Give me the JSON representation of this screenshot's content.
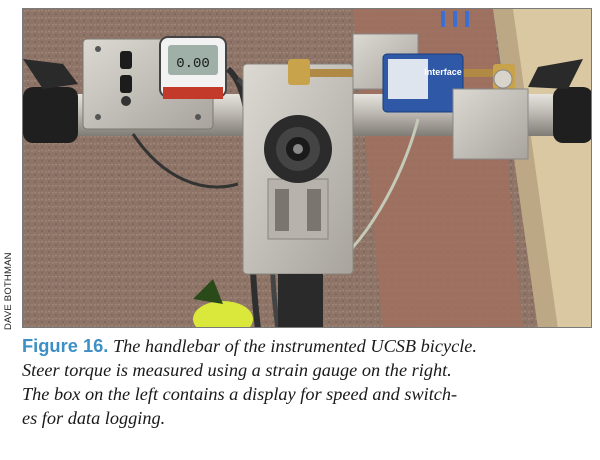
{
  "figure": {
    "label": "Figure 16.",
    "caption_lines": [
      "The handlebar of the instrumented UCSB bicycle.",
      "Steer torque is measured using a strain gauge on the right.",
      "The box on the left contains a  display for speed and switch-",
      "es for data logging."
    ],
    "photo_credit": "DAVE BOTHMAN"
  },
  "photo": {
    "display_readout": "0.00",
    "sensor_brand": "Interface",
    "description_colors": {
      "pavement": "#8d7467",
      "aluminum": "#c9c6c0",
      "cable": "#3a3a3a",
      "fabric_yellow": "#d9e83a"
    }
  }
}
